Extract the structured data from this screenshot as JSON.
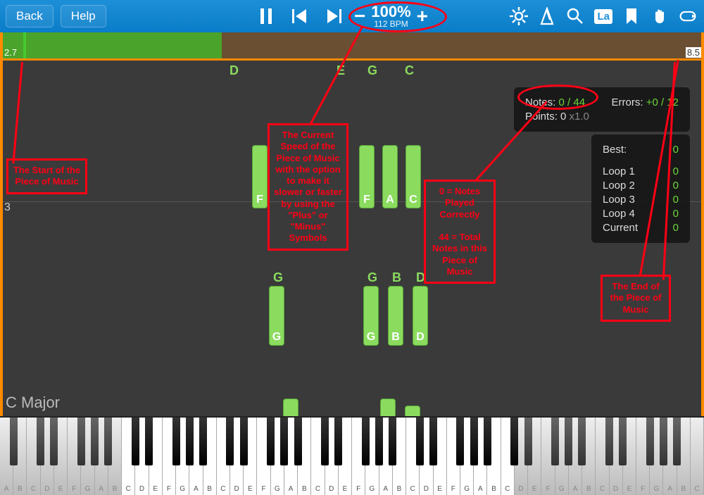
{
  "toolbar": {
    "back": "Back",
    "help": "Help",
    "speed_pct": "100%",
    "bpm": "112 BPM",
    "la_badge": "La"
  },
  "timeline": {
    "left_label": "2.7",
    "right_label": "8.5"
  },
  "chord_label": "C Major",
  "measure_number": "3",
  "top_note_labels": [
    "D",
    "E",
    "G",
    "C"
  ],
  "middle_notes": [
    "F",
    "F",
    "A",
    "C"
  ],
  "lower_labels": [
    "G",
    "G",
    "B",
    "D"
  ],
  "lower_notes": [
    "G",
    "G",
    "B",
    "D"
  ],
  "score": {
    "notes_label": "Notes:",
    "notes_value": "0 / 44",
    "errors_label": "Errors:",
    "errors_value": "+0 / 12",
    "points_label": "Points:",
    "points_value": "0",
    "points_mult": "x1.0"
  },
  "loops": {
    "best_label": "Best:",
    "best_value": "0",
    "rows": [
      {
        "label": "Loop 1",
        "value": "0"
      },
      {
        "label": "Loop 2",
        "value": "0"
      },
      {
        "label": "Loop 3",
        "value": "0"
      },
      {
        "label": "Loop 4",
        "value": "0"
      },
      {
        "label": "Current",
        "value": "0"
      }
    ]
  },
  "annotations": {
    "start": "The Start of the Piece of Music",
    "speed": "The Current Speed of the Piece of Music with the option to make it slower or faster by using the \"Plus\" or \"Minus\" Symbols",
    "notes_expl": "0 = Notes Played Correctly\n\n44 = Total Notes in this Piece of Music",
    "end": "The End of the Piece of Music"
  },
  "white_key_letters": [
    "A",
    "B",
    "C",
    "D",
    "E",
    "F",
    "G",
    "A",
    "B",
    "C",
    "D",
    "E",
    "F",
    "G",
    "A",
    "B",
    "C",
    "D",
    "E",
    "F",
    "G",
    "A",
    "B",
    "C",
    "D",
    "E",
    "F",
    "G",
    "A",
    "B",
    "C",
    "D",
    "E",
    "F",
    "G",
    "A",
    "B",
    "C",
    "D",
    "E",
    "F",
    "G",
    "A",
    "B",
    "C",
    "D",
    "E",
    "F",
    "G",
    "A",
    "B",
    "C"
  ]
}
